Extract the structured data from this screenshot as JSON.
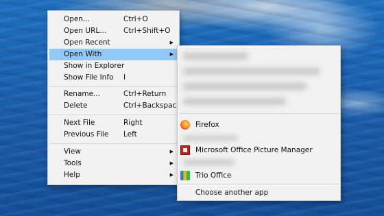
{
  "colors": {
    "menu_background": "#f2f2f2",
    "menu_highlight": "#90c8f6",
    "menu_border": "#c9c9c9"
  },
  "context_menu": {
    "items": [
      {
        "label": "Open...",
        "shortcut": "Ctrl+O"
      },
      {
        "label": "Open URL...",
        "shortcut": "Ctrl+Shift+O"
      },
      {
        "label": "Open Recent",
        "shortcut": "",
        "submenu": true
      },
      {
        "label": "Open With",
        "shortcut": "",
        "submenu": true,
        "highlighted": true
      },
      {
        "label": "Show in Explorer",
        "shortcut": ""
      },
      {
        "label": "Show File Info",
        "shortcut": "I"
      },
      {
        "label": "Rename...",
        "shortcut": "Ctrl+Return"
      },
      {
        "label": "Delete",
        "shortcut": "Ctrl+Backspace"
      },
      {
        "label": "Next File",
        "shortcut": "Right"
      },
      {
        "label": "Previous File",
        "shortcut": "Left"
      },
      {
        "label": "View",
        "shortcut": "",
        "submenu": true
      },
      {
        "label": "Tools",
        "shortcut": "",
        "submenu": true
      },
      {
        "label": "Help",
        "shortcut": "",
        "submenu": true
      }
    ]
  },
  "open_with_submenu": {
    "apps": [
      {
        "label": "Firefox",
        "icon": "firefox-icon"
      },
      {
        "label": "Microsoft Office Picture Manager",
        "icon": "picture-manager-icon"
      },
      {
        "label": "Trio Office",
        "icon": "trio-office-icon"
      }
    ],
    "choose_another": "Choose another app"
  }
}
